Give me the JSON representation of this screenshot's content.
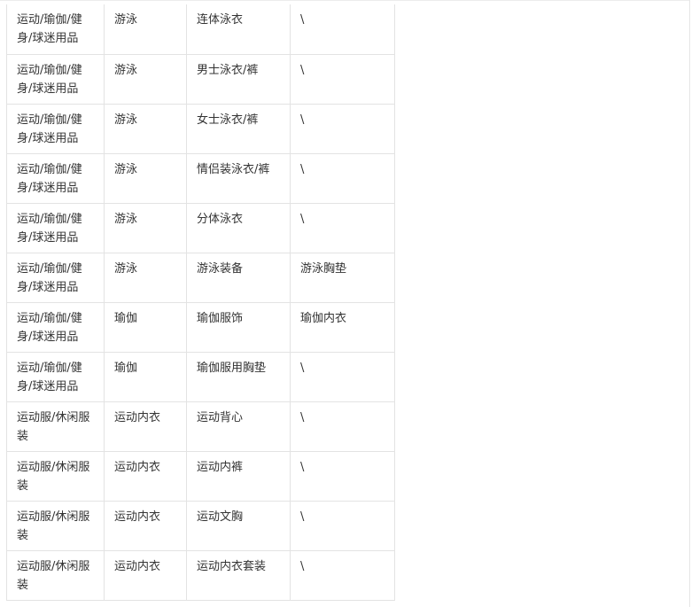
{
  "table": {
    "rows": [
      [
        "运动/瑜伽/健身/球迷用品",
        "游泳",
        "连体泳衣",
        "\\"
      ],
      [
        "运动/瑜伽/健身/球迷用品",
        "游泳",
        "男士泳衣/裤",
        "\\"
      ],
      [
        "运动/瑜伽/健身/球迷用品",
        "游泳",
        "女士泳衣/裤",
        "\\"
      ],
      [
        "运动/瑜伽/健身/球迷用品",
        "游泳",
        "情侣装泳衣/裤",
        "\\"
      ],
      [
        "运动/瑜伽/健身/球迷用品",
        "游泳",
        "分体泳衣",
        "\\"
      ],
      [
        "运动/瑜伽/健身/球迷用品",
        "游泳",
        "游泳装备",
        "游泳胸垫"
      ],
      [
        "运动/瑜伽/健身/球迷用品",
        "瑜伽",
        "瑜伽服饰",
        "瑜伽内衣"
      ],
      [
        "运动/瑜伽/健身/球迷用品",
        "瑜伽",
        "瑜伽服用胸垫",
        "\\"
      ],
      [
        "运动服/休闲服装",
        "运动内衣",
        "运动背心",
        "\\"
      ],
      [
        "运动服/休闲服装",
        "运动内衣",
        "运动内裤",
        "\\"
      ],
      [
        "运动服/休闲服装",
        "运动内衣",
        "运动文胸",
        "\\"
      ],
      [
        "运动服/休闲服装",
        "运动内衣",
        "运动内衣套装",
        "\\"
      ]
    ]
  }
}
